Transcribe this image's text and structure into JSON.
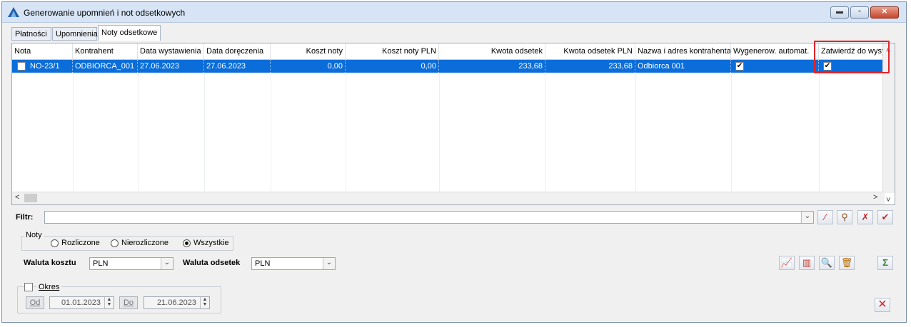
{
  "window": {
    "title": "Generowanie upomnień i not odsetkowych",
    "buttons": [
      "minimize",
      "maximize",
      "close"
    ]
  },
  "tabs": [
    {
      "label": "Płatności",
      "active": false
    },
    {
      "label": "Upomnienia",
      "active": false
    },
    {
      "label": "Noty odsetkowe",
      "active": true
    }
  ],
  "grid": {
    "columns": [
      "Nota",
      "Kontrahent",
      "Data wystawienia",
      "Data doręczenia",
      "Koszt noty",
      "Koszt noty PLN",
      "Kwota odsetek",
      "Kwota odsetek PLN",
      "Nazwa i adres kontrahenta",
      "Wygenerow. automat.",
      "Zatwierdź do wysył"
    ],
    "rows": [
      {
        "selected_checkbox": false,
        "nota": "NO-23/1",
        "kontrahent": "ODBIORCA_001",
        "data_wystawienia": "27.06.2023",
        "data_doreczenia": "27.06.2023",
        "koszt_noty": "0,00",
        "koszt_noty_pln": "0,00",
        "kwota_odsetek": "233,68",
        "kwota_odsetek_pln": "233,68",
        "nazwa": "Odbiorca 001",
        "wygenerow_automat": true,
        "zatwierdz": true
      }
    ]
  },
  "filter": {
    "label": "Filtr:",
    "value": ""
  },
  "toolbar_icons": [
    "clear-filter-icon",
    "search-filter-icon",
    "remove-filter-icon",
    "apply-filter-icon"
  ],
  "noty_group": {
    "label": "Noty",
    "options": [
      "Rozliczone",
      "Nierozliczone",
      "Wszystkie"
    ],
    "selected": "Wszystkie"
  },
  "currency": {
    "cost_label": "Waluta kosztu",
    "cost_value": "PLN",
    "interest_label": "Waluta odsetek",
    "interest_value": "PLN"
  },
  "action_icons": [
    "chart-icon",
    "columns-icon",
    "magnifier-icon",
    "trash-icon",
    "sum-icon"
  ],
  "period": {
    "label": "Okres",
    "checked": false,
    "from_label": "Od",
    "from_value": "01.01.2023",
    "to_label": "Do",
    "to_value": "21.06.2023"
  },
  "colors": {
    "selection": "#0a6dd9",
    "highlight_box": "#e0242b",
    "titlebar": "#d6e4f5"
  }
}
